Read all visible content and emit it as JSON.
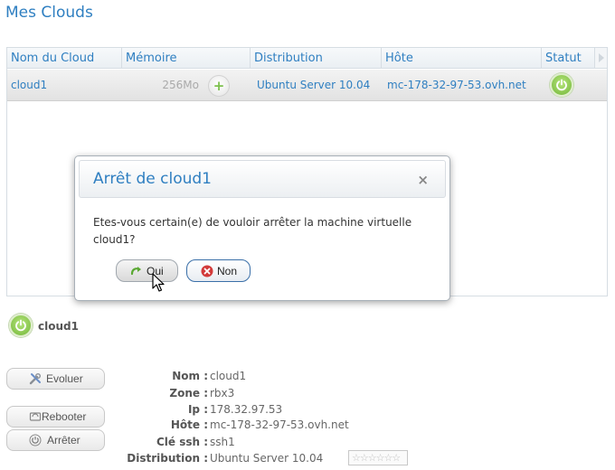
{
  "page": {
    "title": "Mes Clouds"
  },
  "table": {
    "headers": {
      "name": "Nom du Cloud",
      "memory": "Mémoire",
      "distribution": "Distribution",
      "host": "Hôte",
      "status": "Statut"
    },
    "rows": [
      {
        "name": "cloud1",
        "memory": "256Mo",
        "distribution": "Ubuntu Server 10.04",
        "host": "mc-178-32-97-53.ovh.net",
        "status": "on"
      }
    ]
  },
  "modal": {
    "title": "Arrêt de cloud1",
    "close": "×",
    "message": "Etes-vous certain(e) de vouloir arrêter la machine virtuelle cloud1?",
    "yes_label": "Oui",
    "no_label": "Non"
  },
  "vm": {
    "name": "cloud1",
    "actions": {
      "evolve": "Evoluer",
      "reboot": "Rebooter",
      "stop": "Arrêter"
    },
    "details": [
      {
        "label": "Nom :",
        "value": "cloud1"
      },
      {
        "label": "Zone :",
        "value": "rbx3"
      },
      {
        "label": "Ip :",
        "value": "178.32.97.53"
      },
      {
        "label": "Hôte :",
        "value": "mc-178-32-97-53.ovh.net"
      },
      {
        "label": "Clé ssh :",
        "value": "ssh1"
      },
      {
        "label": "Distribution :",
        "value": "Ubuntu Server 10.04"
      }
    ],
    "rating_stars": "☆☆☆☆☆☆"
  },
  "colors": {
    "accent": "#2f7fc1",
    "power_green": "#72b638",
    "no_button_border": "#3a6fa8"
  }
}
